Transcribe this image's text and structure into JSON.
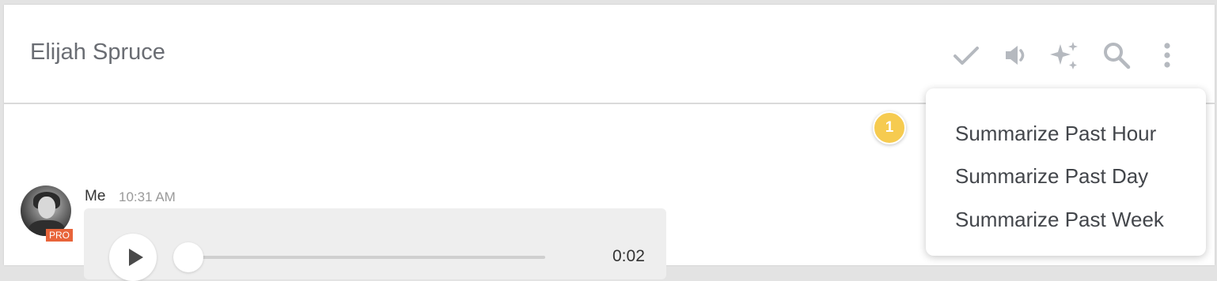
{
  "header": {
    "title": "Elijah Spruce",
    "icons": [
      "check-icon",
      "speaker-icon",
      "sparkle-icon",
      "search-icon",
      "more-vert-icon"
    ]
  },
  "notification": {
    "count": "1"
  },
  "message": {
    "sender": "Me",
    "time": "10:31 AM",
    "badge": "PRO",
    "audio": {
      "duration": "0:02"
    }
  },
  "menu": {
    "items": [
      {
        "label": "Summarize Past Hour"
      },
      {
        "label": "Summarize Past Day"
      },
      {
        "label": "Summarize Past Week"
      }
    ]
  },
  "colors": {
    "icon": "#b5b9bf",
    "badge": "#f6cb50",
    "pro": "#e8643a",
    "bubble": "#eeeeee"
  }
}
